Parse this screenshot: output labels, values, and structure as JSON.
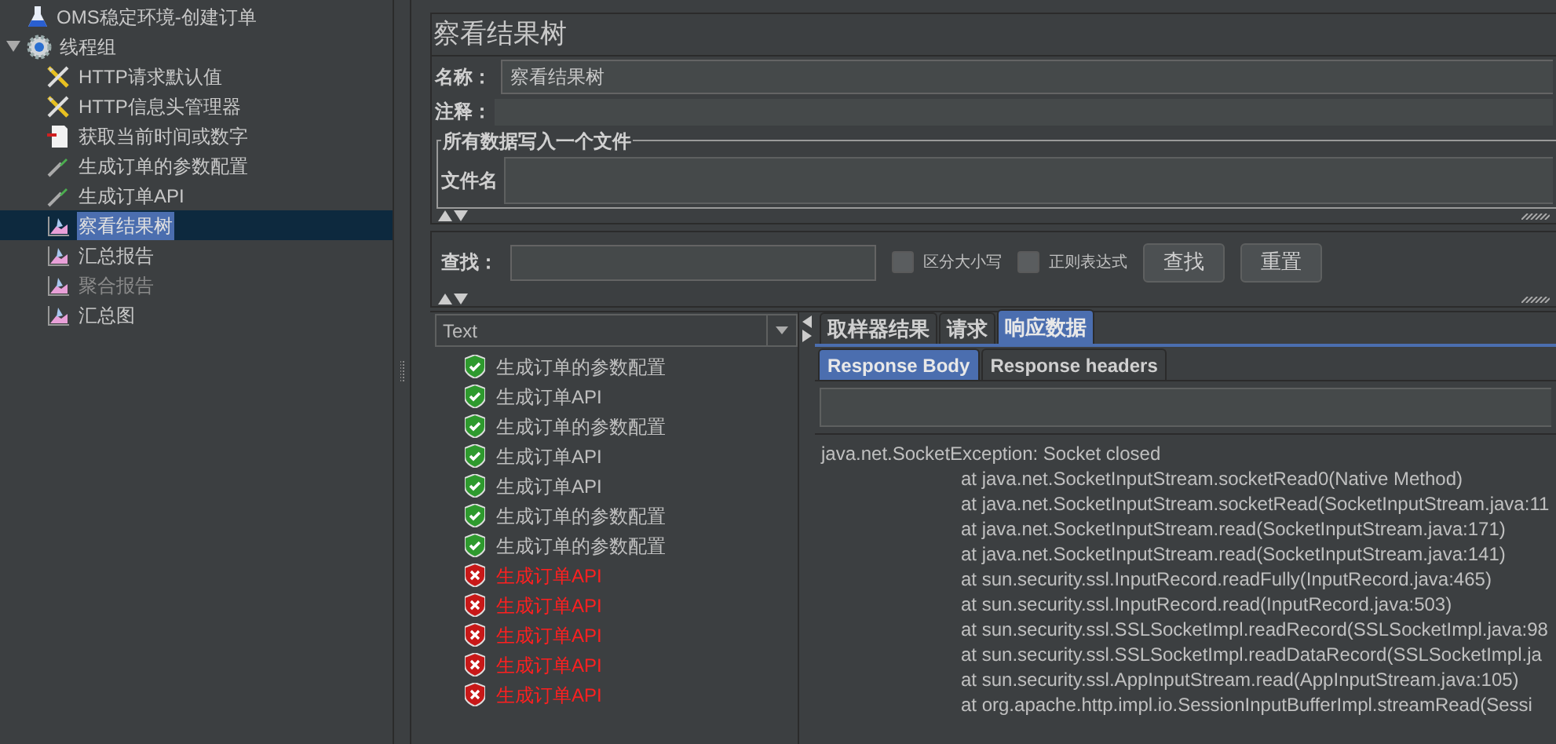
{
  "tree": {
    "items": [
      {
        "label": "OMS稳定环境-创建订单",
        "kind": "testplan",
        "selected": false,
        "disabled": false,
        "children": [
          {
            "label": "线程组",
            "kind": "threadgroup",
            "selected": false,
            "disabled": false,
            "expanded": true,
            "children": [
              {
                "label": "HTTP请求默认值",
                "kind": "config",
                "selected": false,
                "disabled": false
              },
              {
                "label": "HTTP信息头管理器",
                "kind": "config",
                "selected": false,
                "disabled": false
              },
              {
                "label": "获取当前时间或数字",
                "kind": "preprocessor",
                "selected": false,
                "disabled": false
              },
              {
                "label": "生成订单的参数配置",
                "kind": "sampler",
                "selected": false,
                "disabled": false
              },
              {
                "label": "生成订单API",
                "kind": "sampler",
                "selected": false,
                "disabled": false
              },
              {
                "label": "察看结果树",
                "kind": "listener",
                "selected": true,
                "disabled": false
              },
              {
                "label": "汇总报告",
                "kind": "listener",
                "selected": false,
                "disabled": false
              },
              {
                "label": "聚合报告",
                "kind": "listener",
                "selected": false,
                "disabled": true
              },
              {
                "label": "汇总图",
                "kind": "listener",
                "selected": false,
                "disabled": false
              }
            ]
          }
        ]
      }
    ]
  },
  "panel": {
    "title": "察看结果树",
    "name_label": "名称：",
    "name_value": "察看结果树",
    "comment_label": "注释：",
    "file_group": "所有数据写入一个文件",
    "file_label": "文件名"
  },
  "search": {
    "label": "查找：",
    "options": [
      {
        "label": "区分大小写",
        "checked": false
      },
      {
        "label": "正则表达式",
        "checked": false
      }
    ],
    "buttons": [
      "查找",
      "重置"
    ]
  },
  "results": {
    "renderer": "Text",
    "items": [
      {
        "label": "生成订单的参数配置",
        "passed": true
      },
      {
        "label": "生成订单API",
        "passed": true
      },
      {
        "label": "生成订单的参数配置",
        "passed": true
      },
      {
        "label": "生成订单API",
        "passed": true
      },
      {
        "label": "生成订单API",
        "passed": true
      },
      {
        "label": "生成订单的参数配置",
        "passed": true
      },
      {
        "label": "生成订单的参数配置",
        "passed": true
      },
      {
        "label": "生成订单API",
        "passed": false
      },
      {
        "label": "生成订单API",
        "passed": false
      },
      {
        "label": "生成订单API",
        "passed": false
      },
      {
        "label": "生成订单API",
        "passed": false
      },
      {
        "label": "生成订单API",
        "passed": false
      }
    ]
  },
  "detail": {
    "tabs": [
      {
        "label": "取样器结果",
        "selected": false
      },
      {
        "label": "请求",
        "selected": false
      },
      {
        "label": "响应数据",
        "selected": true
      }
    ],
    "subtabs": [
      {
        "label": "Response Body",
        "selected": true
      },
      {
        "label": "Response headers",
        "selected": false
      }
    ],
    "body": [
      "java.net.SocketException: Socket closed",
      "at java.net.SocketInputStream.socketRead0(Native Method)",
      "at java.net.SocketInputStream.socketRead(SocketInputStream.java:11",
      "at java.net.SocketInputStream.read(SocketInputStream.java:171)",
      "at java.net.SocketInputStream.read(SocketInputStream.java:141)",
      "at sun.security.ssl.InputRecord.readFully(InputRecord.java:465)",
      "at sun.security.ssl.InputRecord.read(InputRecord.java:503)",
      "at sun.security.ssl.SSLSocketImpl.readRecord(SSLSocketImpl.java:98",
      "at sun.security.ssl.SSLSocketImpl.readDataRecord(SSLSocketImpl.ja",
      "at sun.security.ssl.AppInputStream.read(AppInputStream.java:105)",
      "at org.apache.http.impl.io.SessionInputBufferImpl.streamRead(Sessi"
    ]
  }
}
